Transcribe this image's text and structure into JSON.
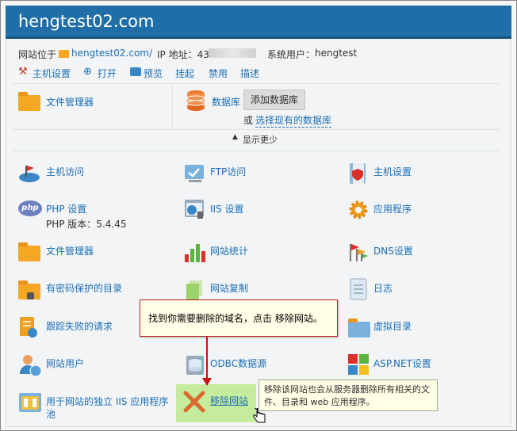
{
  "header": {
    "title": "hengtest02.com"
  },
  "info": {
    "site_location_label": "网站位于",
    "site_path": "hengtest02.com/",
    "ip_label": "IP 地址：43.",
    "system_user_label": "系统用户：",
    "system_user": "hengtest"
  },
  "toolbar": {
    "host_settings": "主机设置",
    "open": "打开",
    "preview": "预览",
    "suspend": "挂起",
    "disable": "禁用",
    "describe": "描述"
  },
  "top": {
    "file_manager": "文件管理器",
    "database": "数据库",
    "add_database": "添加数据库",
    "or": "或",
    "select_existing_db": "选择现有的数据库",
    "show_less": "显示更少"
  },
  "tools": {
    "host_access": "主机访问",
    "ftp_access": "FTP访问",
    "host_settings": "主机设置",
    "php_settings": "PHP 设置",
    "php_version": "PHP 版本：5.4.45",
    "iis_settings": "IIS 设置",
    "apps": "应用程序",
    "file_manager": "文件管理器",
    "site_stats": "网站统计",
    "dns_settings": "DNS设置",
    "protected_dirs": "有密码保护的目录",
    "site_copy": "网站复制",
    "logs": "日志",
    "failed_requests": "跟踪失败的请求",
    "virtual_dirs": "虚拟目录",
    "web_users": "网站用户",
    "odbc": "ODBC数据源",
    "aspnet": "ASP.NET设置",
    "iis_pool_line1": "用于网站的独立 IIS 应用程序",
    "iis_pool_line2": "池",
    "remove_site": "移除网站"
  },
  "annotation": {
    "callout": "找到你需要删除的域名，点击 移除网站。"
  },
  "hint": {
    "text": "移除该网站也会从服务器删除所有相关的文件、目录和 web 应用程序。"
  },
  "colors": {
    "header": "#1f6ea8",
    "link": "#1a6eb5",
    "highlight": "#c5ec9c",
    "callout_border": "#c02020"
  }
}
